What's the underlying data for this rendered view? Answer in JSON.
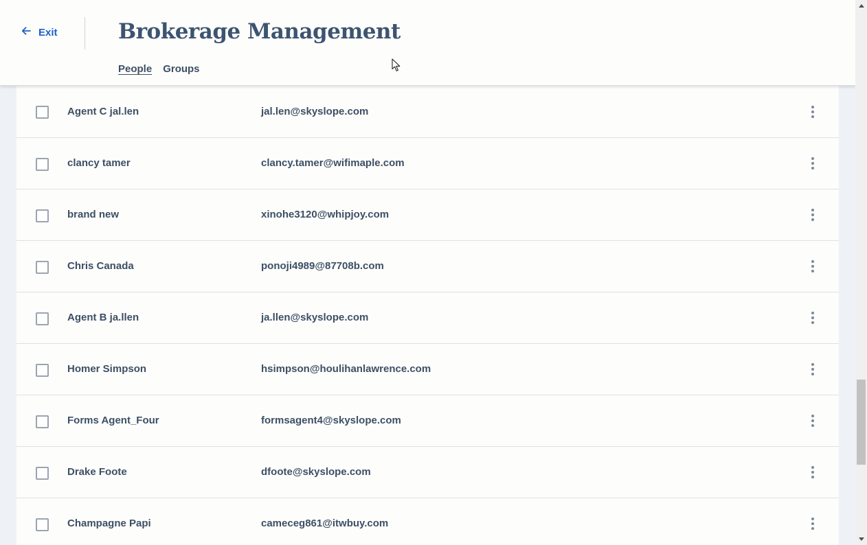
{
  "header": {
    "exit_label": "Exit",
    "title": "Brokerage Management",
    "tabs": [
      {
        "label": "People",
        "active": true
      },
      {
        "label": "Groups",
        "active": false
      }
    ]
  },
  "people": [
    {
      "name": "Agent C jal.len",
      "email": "jal.len@skyslope.com"
    },
    {
      "name": "clancy tamer",
      "email": "clancy.tamer@wifimaple.com"
    },
    {
      "name": "brand new",
      "email": "xinohe3120@whipjoy.com"
    },
    {
      "name": "Chris Canada",
      "email": "ponoji4989@87708b.com"
    },
    {
      "name": "Agent B ja.llen",
      "email": "ja.llen@skyslope.com"
    },
    {
      "name": "Homer Simpson",
      "email": "hsimpson@houlihanlawrence.com"
    },
    {
      "name": "Forms Agent_Four",
      "email": "formsagent4@skyslope.com"
    },
    {
      "name": "Drake Foote",
      "email": "dfoote@skyslope.com"
    },
    {
      "name": "Champagne Papi",
      "email": "cameceg861@itwbuy.com"
    }
  ],
  "icons": {
    "exit": "arrow-left-icon",
    "row_menu": "more-vertical-icon",
    "checkbox": "checkbox-unchecked"
  },
  "colors": {
    "accent": "#1c60c8",
    "title": "#3d5470",
    "text": "#3d4f64",
    "background": "#eef1f6"
  }
}
